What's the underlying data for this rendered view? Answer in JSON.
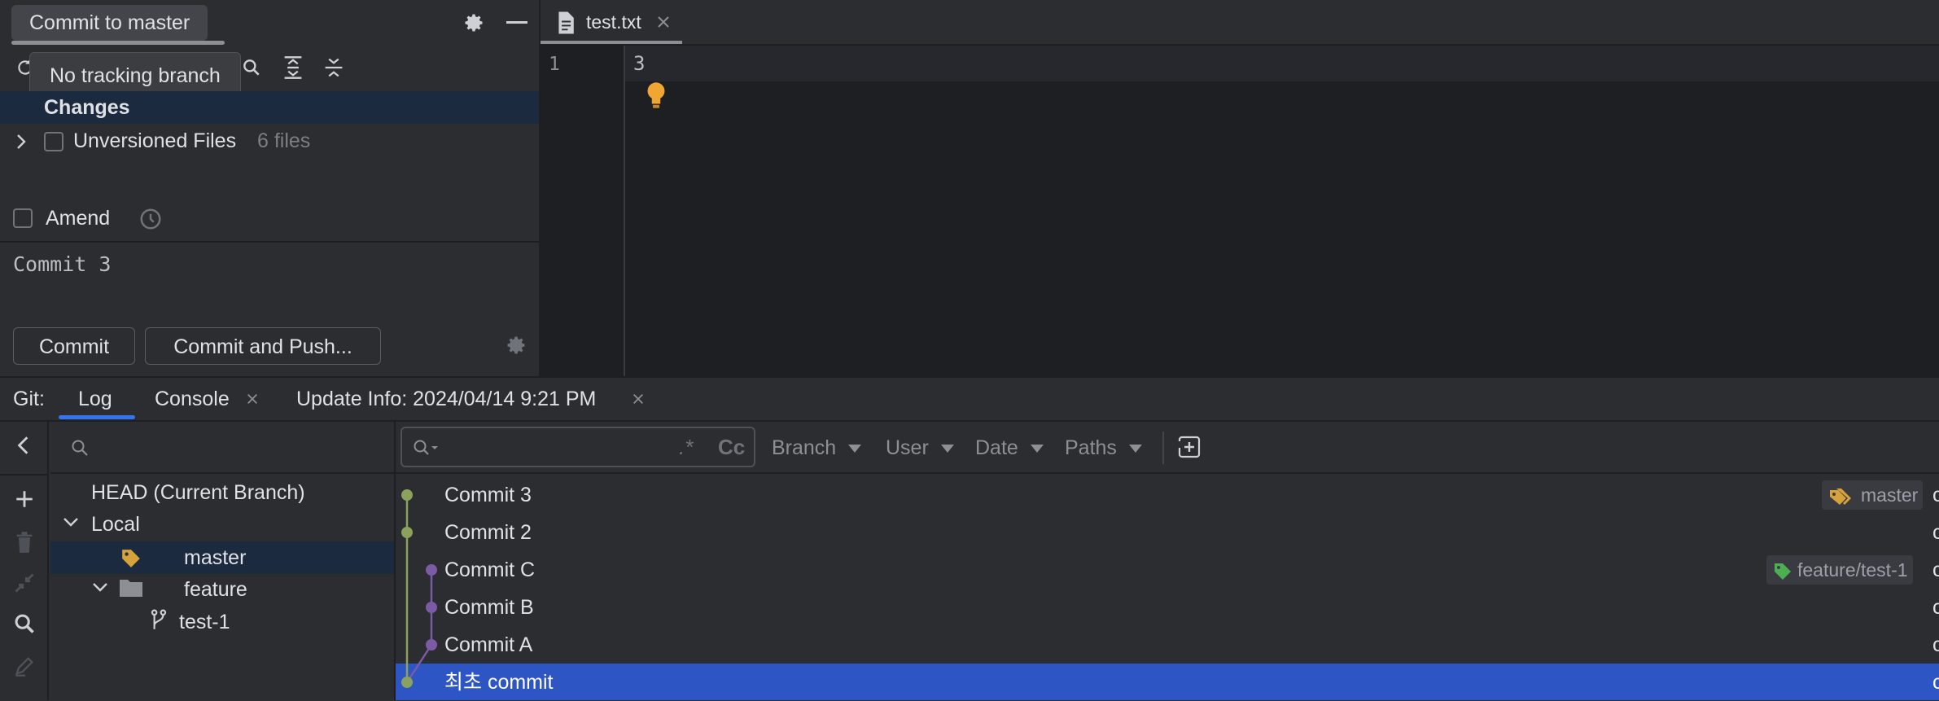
{
  "colors": {
    "accent": "#3574f0",
    "selected_row": "#2e55c4",
    "graph_green": "#8aa25e",
    "graph_purple": "#7b5aa6",
    "tag_yellow": "#d6a33a",
    "tag_green": "#4caf50",
    "bulb": "#f0a732"
  },
  "commit_panel": {
    "title": "Commit to master",
    "tooltip": "No tracking branch",
    "changes_label": "Changes",
    "unversioned_label": "Unversioned Files",
    "unversioned_count": "6 files",
    "amend_label": "Amend",
    "message": "Commit 3",
    "commit_button": "Commit",
    "commit_push_button": "Commit and Push..."
  },
  "editor": {
    "tab_label": "test.txt",
    "line_number": "1",
    "line_text": "3"
  },
  "git": {
    "prefix": "Git:",
    "tabs": [
      {
        "label": "Log"
      },
      {
        "label": "Console"
      },
      {
        "label": "Update Info: 2024/04/14 9:21 PM"
      }
    ],
    "branches": {
      "head": "HEAD (Current Branch)",
      "local": "Local",
      "master": "master",
      "feature": "feature",
      "test1": "test-1"
    },
    "filters": {
      "regex": ".*",
      "case": "Cc",
      "branch": "Branch",
      "user": "User",
      "date": "Date",
      "paths": "Paths"
    },
    "commits": [
      {
        "message": "Commit 3",
        "ref": "master"
      },
      {
        "message": "Commit 2"
      },
      {
        "message": "Commit C",
        "ref": "feature/test-1"
      },
      {
        "message": "Commit B"
      },
      {
        "message": "Commit A"
      },
      {
        "message": "최초 commit"
      }
    ],
    "overflow_char": "c"
  }
}
